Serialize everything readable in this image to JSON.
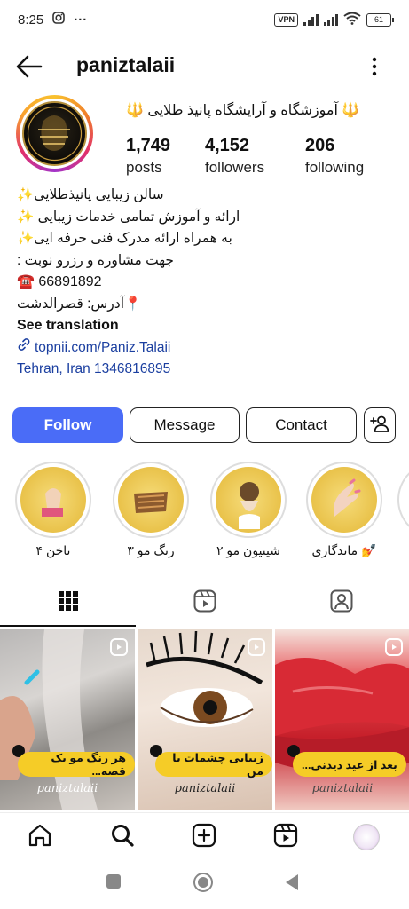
{
  "status_bar": {
    "time": "8:25",
    "more_dots": "···",
    "vpn_label": "VPN",
    "battery": "61"
  },
  "header": {
    "username": "paniztalaii"
  },
  "profile": {
    "display_name": "🔱 آموزشگاه و آرایشگاه پانیذ طلایی 🔱",
    "stats": [
      {
        "value": "1,749",
        "label": "posts"
      },
      {
        "value": "4,152",
        "label": "followers"
      },
      {
        "value": "206",
        "label": "following"
      }
    ],
    "bio_lines": [
      "سالن زیبایی پانیذطلایی✨",
      "ارائه و آموزش تمامی خدمات زیبایی ✨",
      "به همراه ارائه مدرک فنی حرفه ایی✨",
      "جهت مشاوره و رزرو نوبت :",
      "☎️ 66891892",
      "📍آدرس: قصرالدشت"
    ],
    "see_translation": "See translation",
    "link": "topnii.com/Paniz.Talaii",
    "location": "Tehran, Iran 1346816895"
  },
  "actions": {
    "follow": "Follow",
    "message": "Message",
    "contact": "Contact"
  },
  "highlights": [
    {
      "label": "ناخن ۴"
    },
    {
      "label": "رنگ مو ۳"
    },
    {
      "label": "شینیون مو ۲"
    },
    {
      "label": "💅 ماندگاری"
    }
  ],
  "grid": [
    {
      "caption": "هر رنگ مو یک قصه...",
      "watermark": "paniztalaii"
    },
    {
      "caption": "زیبایی چشمات با من",
      "watermark": "paniztalaii"
    },
    {
      "caption": "بعد از عید دیدنی...",
      "watermark": "paniztalaii"
    }
  ],
  "colors": {
    "follow_button": "#4a6cf7",
    "link": "#1b3fa0",
    "highlight_gold": "#e9c24a",
    "caption_pill": "#f5cc27"
  }
}
